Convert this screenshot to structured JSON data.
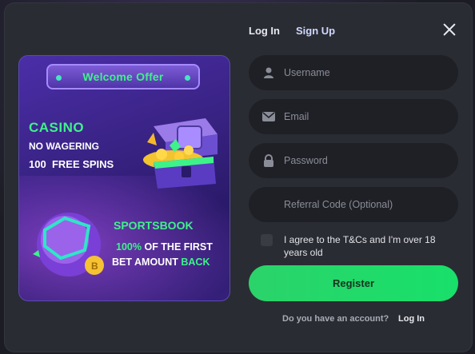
{
  "tabs": {
    "login": "Log In",
    "signup": "Sign Up"
  },
  "promo": {
    "welcome": "Welcome Offer",
    "casino": "CASINO",
    "no_wagering": "NO WAGERING",
    "spins_count": "100",
    "spins_label": "FREE SPINS",
    "sportsbook": "SPORTSBOOK",
    "first_pct": "100%",
    "first_rest": "OF THE FIRST",
    "bet_amount": "BET AMOUNT",
    "back": "BACK"
  },
  "form": {
    "username_placeholder": "Username",
    "email_placeholder": "Email",
    "password_placeholder": "Password",
    "referral_placeholder": "Referral Code (Optional)",
    "agree_label": "I agree to the T&Cs and I'm over 18 years old",
    "register_label": "Register"
  },
  "footer": {
    "have_account": "Do you have an account?",
    "login_link": "Log In"
  },
  "colors": {
    "accent_green": "#3ef28a",
    "button_green": "#1fd86a",
    "panel": "#2a2c33",
    "field": "#1f2026"
  },
  "icons": [
    "close-icon",
    "user-icon",
    "email-icon",
    "lock-icon"
  ]
}
